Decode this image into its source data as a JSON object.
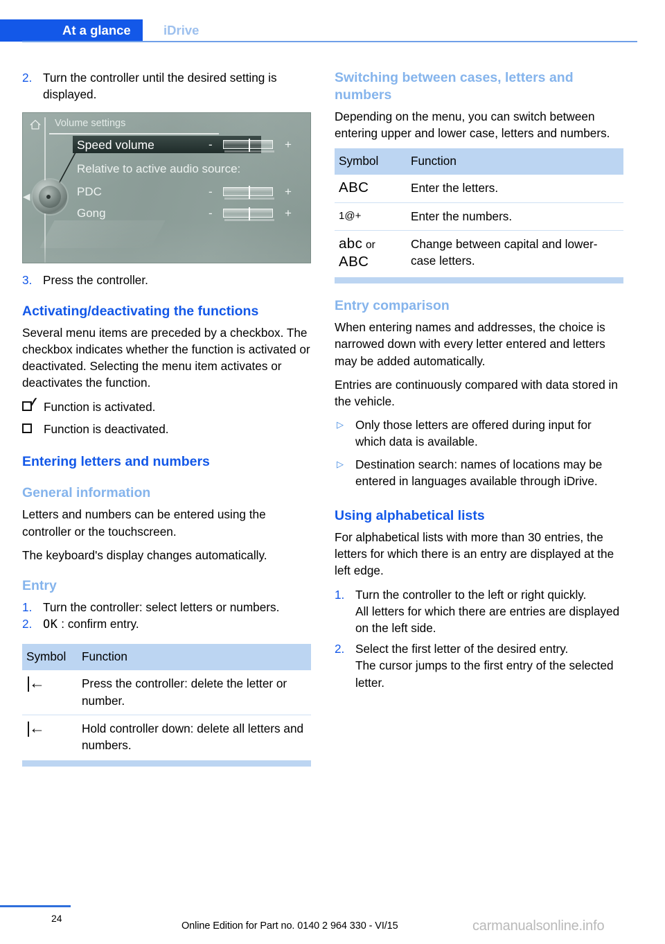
{
  "header": {
    "active_tab": "At a glance",
    "inactive_tab": "iDrive"
  },
  "left_column": {
    "step2": {
      "num": "2.",
      "text": "Turn the controller until the desired setting is displayed."
    },
    "idrive_screen": {
      "home_icon": "home-icon",
      "title": "Volume settings",
      "selected_row": "Speed volume",
      "section_label": "Relative to active audio source:",
      "row_pdc": "PDC",
      "row_gong": "Gong",
      "minus": "-",
      "plus": "+"
    },
    "step3": {
      "num": "3.",
      "text": "Press the controller."
    },
    "heading_activating": "Activating/deactivating the functions",
    "para_activating": "Several menu items are preceded by a checkbox. The checkbox indicates whether the function is activated or deactivated. Selecting the menu item activates or deactivates the function.",
    "checkbox_on_text": "Function is activated.",
    "checkbox_off_text": "Function is deactivated.",
    "heading_entering": "Entering letters and numbers",
    "heading_general": "General information",
    "para_general_1": "Letters and numbers can be entered using the controller or the touchscreen.",
    "para_general_2": "The keyboard's display changes automatically.",
    "heading_entry": "Entry",
    "entry_steps": [
      {
        "num": "1.",
        "text": "Turn the controller: select letters or numbers."
      },
      {
        "num": "2.",
        "symbol": "OK",
        "text": ": confirm entry."
      }
    ],
    "table": {
      "head_symbol": "Symbol",
      "head_function": "Function",
      "rows": [
        {
          "symbol": "|←",
          "function": "Press the controller: delete the letter or number."
        },
        {
          "symbol": "|←",
          "function": "Hold controller down: delete all letters and numbers."
        }
      ]
    }
  },
  "right_column": {
    "heading_switching": "Switching between cases, letters and numbers",
    "para_switching": "Depending on the menu, you can switch between entering upper and lower case, letters and numbers.",
    "table": {
      "head_symbol": "Symbol",
      "head_function": "Function",
      "rows": [
        {
          "symbol": "ABC",
          "function": "Enter the letters."
        },
        {
          "symbol": "1@+",
          "function": "Enter the numbers."
        },
        {
          "symbol_a": "abc",
          "symbol_or": "or",
          "symbol_b": "ABC",
          "function": "Change between capital and lower-case letters."
        }
      ]
    },
    "heading_entry_comparison": "Entry comparison",
    "para_comparison_1": "When entering names and addresses, the choice is narrowed down with every letter entered and letters may be added automatically.",
    "para_comparison_2": "Entries are continuously compared with data stored in the vehicle.",
    "bullets": [
      "Only those letters are offered during input for which data is available.",
      "Destination search: names of locations may be entered in languages available through iDrive."
    ],
    "heading_alpha_lists": "Using alphabetical lists",
    "para_alpha": "For alphabetical lists with more than 30 entries, the letters for which there is an entry are displayed at the left edge.",
    "alpha_steps": [
      {
        "num": "1.",
        "text": "Turn the controller to the left or right quickly.",
        "sub": "All letters for which there are entries are displayed on the left side."
      },
      {
        "num": "2.",
        "text": "Select the first letter of the desired entry.",
        "sub": "The cursor jumps to the first entry of the selected letter."
      }
    ]
  },
  "footer": {
    "page_number": "24",
    "note": "Online Edition for Part no. 0140 2 964 330 - VI/15",
    "watermark": "carmanualsonline.info"
  },
  "colors": {
    "accent_blue": "#1358e8",
    "light_blue": "#85b4ec",
    "table_header": "#bcd5f2",
    "idrive_bg": "#8b9c97"
  }
}
